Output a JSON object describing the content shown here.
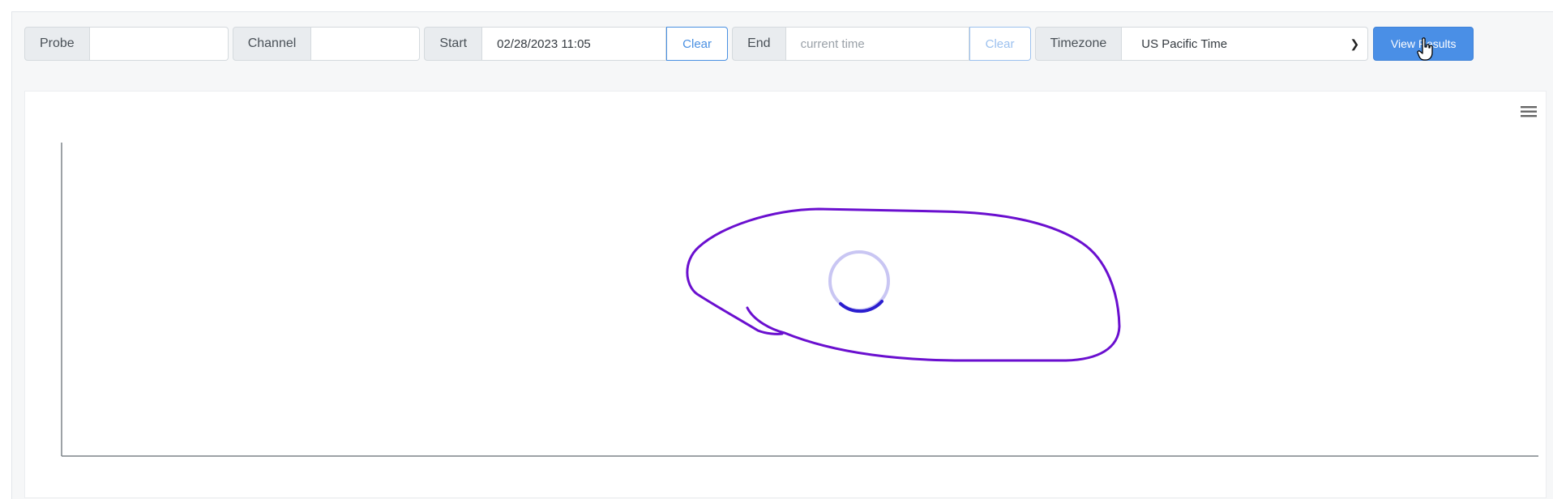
{
  "toolbar": {
    "probe_label": "Probe",
    "probe_value": "",
    "channel_label": "Channel",
    "channel_value": "",
    "start_label": "Start",
    "start_value": "02/28/2023 11:05",
    "start_clear": "Clear",
    "end_label": "End",
    "end_placeholder": "current time",
    "end_clear": "Clear",
    "timezone_label": "Timezone",
    "timezone_value": "US Pacific Time",
    "view_results": "View Results"
  },
  "chart": {
    "loading": true
  },
  "icons": {
    "menu": "hamburger-menu-icon",
    "spinner": "loading-spinner-icon",
    "cursor": "hand-pointer-cursor-icon",
    "chevron": "chevron-down-icon"
  },
  "colors": {
    "primary": "#4a8fe6",
    "spinner_track": "#c9c6f3",
    "spinner_arc": "#2b1ecf",
    "annotation": "#6a0fcf"
  }
}
